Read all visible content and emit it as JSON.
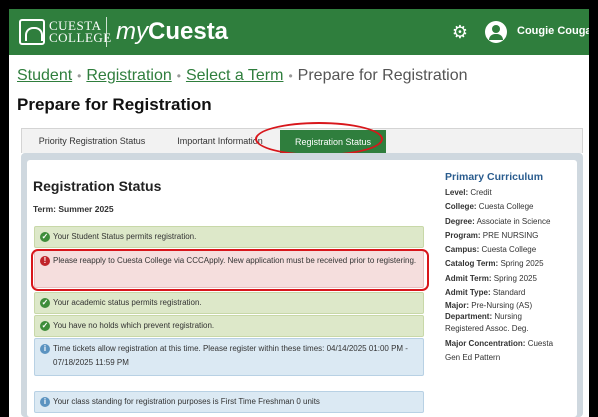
{
  "header": {
    "logo_text": "CUESTA COLLEGE",
    "brand_my": "my",
    "brand_name": "Cuesta",
    "user_name": "Cougie Cougar"
  },
  "breadcrumb": {
    "items": [
      "Student",
      "Registration",
      "Select a Term"
    ],
    "current": "Prepare for Registration"
  },
  "page_title": "Prepare for Registration",
  "tabs": [
    {
      "label": "Priority Registration Status"
    },
    {
      "label": "Important Information"
    },
    {
      "label": "Registration Status",
      "active": true
    }
  ],
  "status": {
    "title": "Registration Status",
    "term": "Term: Summer 2025",
    "messages": [
      {
        "type": "ok",
        "text": "Your Student Status permits registration."
      },
      {
        "type": "err",
        "text": "Please reapply to Cuesta College via CCCApply. New application must be received prior to registering."
      },
      {
        "type": "ok",
        "text": "Your academic status permits registration."
      },
      {
        "type": "ok",
        "text": "You have no holds which prevent registration."
      },
      {
        "type": "info",
        "text": "Time tickets allow registration at this time. Please register within these times: 04/14/2025 01:00 PM - 07/18/2025 11:59 PM"
      },
      {
        "type": "info",
        "text": "Your class standing for registration purposes is First Time Freshman 0 units"
      }
    ]
  },
  "curriculum": {
    "title": "Primary Curriculum",
    "rows": [
      {
        "label": "Level:",
        "value": "Credit"
      },
      {
        "label": "College:",
        "value": "Cuesta College"
      },
      {
        "label": "Degree:",
        "value": "Associate in Science"
      },
      {
        "label": "Program:",
        "value": "PRE NURSING"
      },
      {
        "label": "Campus:",
        "value": "Cuesta College"
      },
      {
        "label": "Catalog Term:",
        "value": "Spring 2025"
      },
      {
        "label": "Admit Term:",
        "value": "Spring 2025"
      },
      {
        "label": "Admit Type:",
        "value": "Standard"
      },
      {
        "label": "Major:",
        "value": "Pre-Nursing (AS)"
      },
      {
        "label": "Department:",
        "value": "Nursing"
      },
      {
        "label": "",
        "value": "Registered Assoc. Deg."
      },
      {
        "label": "Major Concentration:",
        "value": "Cuesta"
      },
      {
        "label": "",
        "value": "Gen Ed Pattern"
      }
    ]
  },
  "icons": {
    "gear": "gear-icon",
    "user": "user-icon",
    "ok": "check-circle-icon",
    "err": "exclamation-circle-icon",
    "info": "info-circle-icon"
  },
  "colors": {
    "brand_green": "#2f7e3d",
    "error_red": "#d8161b",
    "link_blue": "#2a5c8e"
  }
}
